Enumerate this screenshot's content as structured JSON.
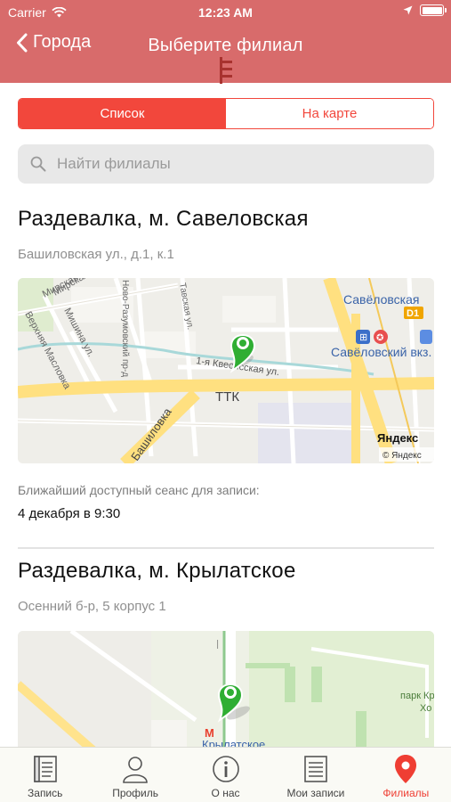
{
  "status_bar": {
    "carrier": "Carrier",
    "time": "12:23 AM"
  },
  "nav": {
    "back_label": "Города",
    "title": "Выберите филиал"
  },
  "segment": {
    "list_label": "Список",
    "map_label": "На карте",
    "selected": "Список"
  },
  "search": {
    "placeholder": "Найти филиалы",
    "value": ""
  },
  "branches": [
    {
      "name": "Раздевалка, м. Савеловская",
      "address": "Башиловская ул., д.1, к.1",
      "map_labels": {
        "metro": "Савёловская",
        "line": "D1",
        "station": "Савёловский вкз.",
        "ring": "ТТК",
        "street_main": "1-я Квесисская ул.",
        "street_bash": "Башиловка",
        "street_mir": "Мирская",
        "street_vm": "Верхняя Масловка",
        "street_mish": "Мишина ул.",
        "street_nr": "Ново-Разумовский пр-д",
        "street_tav": "Тавская ул.",
        "yandex": "Яндекс",
        "copyright": "© Яндекс"
      },
      "session_label": "Ближайший доступный сеанс для записи:",
      "session_value": "4 декабря в 9:30"
    },
    {
      "name": "Раздевалка, м. Крылатское",
      "address": "Осенний б-р, 5 корпус 1",
      "map_labels": {
        "metro_letter": "М",
        "metro": "Крылатское",
        "park": "парк Кр",
        "park2": "Хо"
      }
    }
  ],
  "tabs": [
    {
      "label": "Запись",
      "icon": "book-icon"
    },
    {
      "label": "Профиль",
      "icon": "profile-icon"
    },
    {
      "label": "О нас",
      "icon": "info-icon"
    },
    {
      "label": "Мои записи",
      "icon": "list-icon"
    },
    {
      "label": "Филиалы",
      "icon": "location-pin-icon"
    }
  ],
  "active_tab": "Филиалы",
  "colors": {
    "nav_bg": "#d86b6b",
    "accent": "#f2473c",
    "pin": "#2fae33"
  }
}
